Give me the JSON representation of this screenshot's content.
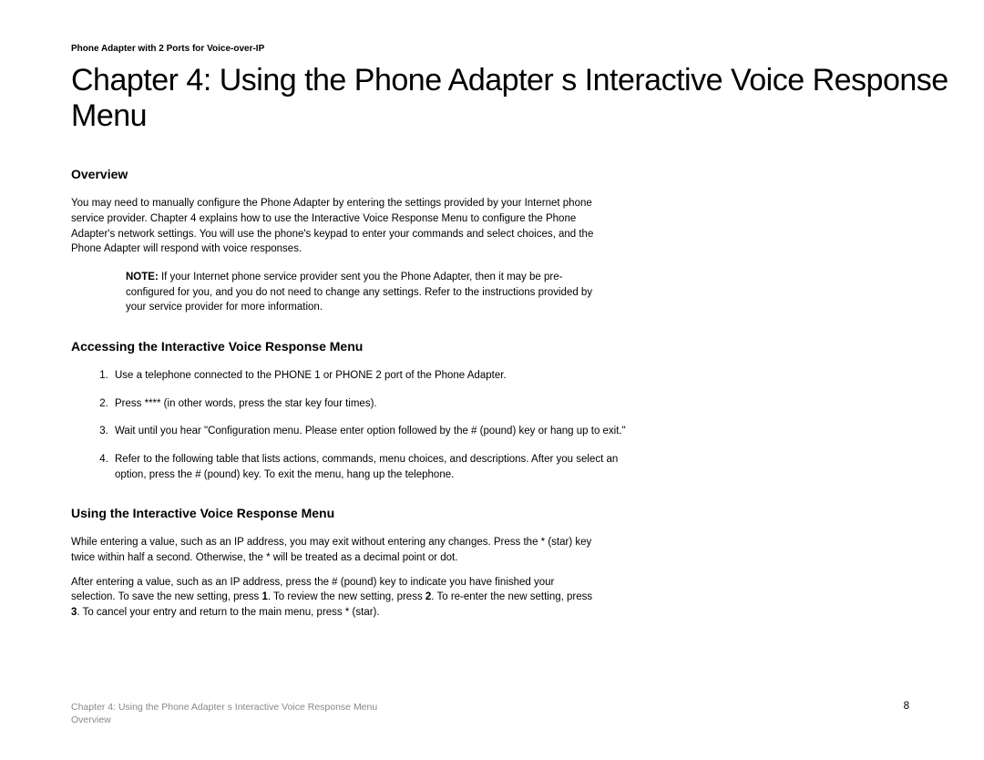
{
  "header": {
    "product_line": "Phone Adapter with 2 Ports for Voice-over-IP"
  },
  "chapter": {
    "title": "Chapter 4: Using the Phone Adapter s Interactive Voice Response Menu"
  },
  "sections": {
    "overview": {
      "heading": "Overview",
      "body": "You may need to manually configure the Phone Adapter by entering the settings provided by your Internet phone service provider. Chapter 4 explains how to use the Interactive Voice Response Menu to configure the Phone Adapter's network settings. You will use the phone's keypad to enter your commands and select choices, and the Phone Adapter will respond with voice responses.",
      "note_label": "NOTE:",
      "note_body": " If your Internet phone service provider sent you the Phone Adapter, then it may be pre-configured for you, and you do not need to change any settings. Refer to the instructions provided by your service provider for more information."
    },
    "accessing": {
      "heading": "Accessing the Interactive Voice Response Menu",
      "steps": [
        "Use a telephone connected to the PHONE 1 or PHONE 2 port of the Phone Adapter.",
        "Press **** (in other words, press the star key four times).",
        "Wait until you hear \"Configuration menu. Please enter option followed by the # (pound) key or hang up to exit.\"",
        "Refer to the following table that lists actions, commands, menu choices, and descriptions. After you select an option, press the # (pound) key. To exit the menu, hang up the telephone."
      ]
    },
    "using": {
      "heading": "Using the Interactive Voice Response Menu",
      "para1": "While entering a value, such as an IP address, you may exit without entering any changes. Press the * (star) key twice within half a second. Otherwise, the * will be treated as a decimal point or dot.",
      "para2_pre": "After entering a value, such as an IP address, press the # (pound) key to indicate you have finished your selection. To save the new setting, press ",
      "para2_b1": "1",
      "para2_mid1": ". To review the new setting, press ",
      "para2_b2": "2",
      "para2_mid2": ". To re-enter the new setting, press ",
      "para2_b3": "3",
      "para2_tail": ". To cancel your entry and return to the main menu, press * (star)."
    }
  },
  "footer": {
    "line1": "Chapter 4: Using the Phone Adapter s Interactive Voice Response Menu",
    "line2": "Overview",
    "page": "8"
  }
}
